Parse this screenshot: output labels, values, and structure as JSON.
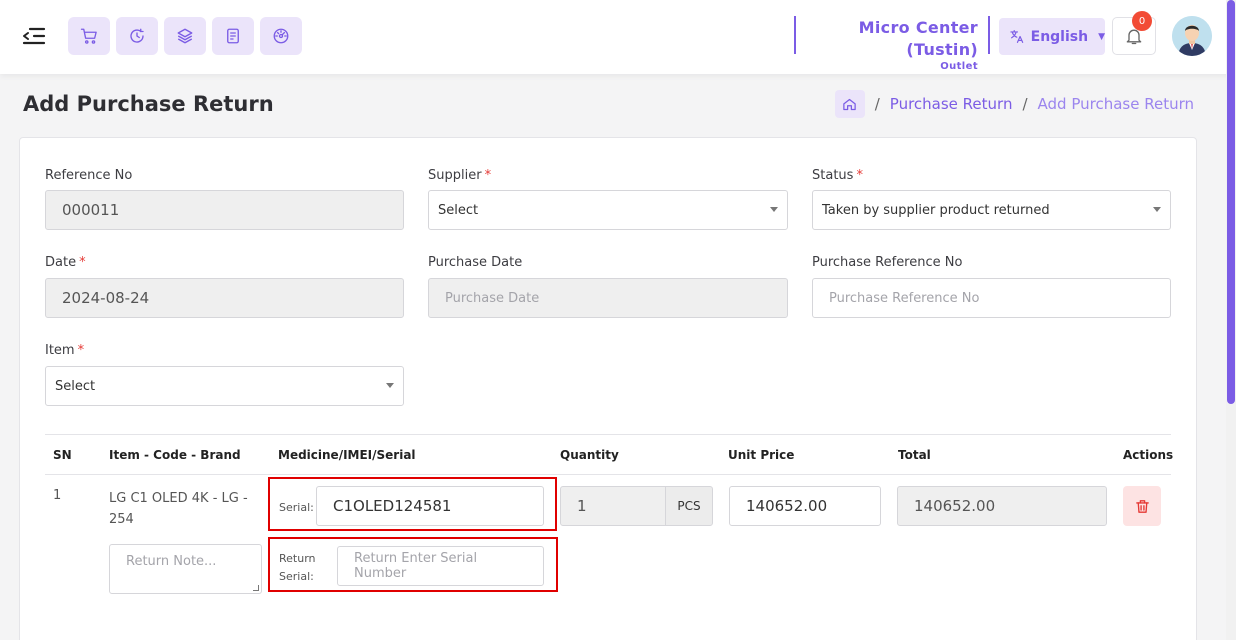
{
  "header": {
    "outlet_name": "Micro Center (Tustin)",
    "outlet_sub": "Outlet",
    "language": "English",
    "notification_count": "0",
    "quick_icons": [
      "cart-icon",
      "clock-icon",
      "layers-icon",
      "receipt-icon",
      "dashboard-icon"
    ]
  },
  "page": {
    "title": "Add Purchase Return",
    "breadcrumb": [
      "Purchase Return",
      "Add Purchase Return"
    ]
  },
  "form": {
    "reference_no": {
      "label": "Reference No",
      "value": "000011"
    },
    "supplier": {
      "label": "Supplier",
      "value": "Select"
    },
    "status": {
      "label": "Status",
      "value": "Taken by supplier product returned"
    },
    "date": {
      "label": "Date",
      "value": "2024-08-24"
    },
    "purchase_date": {
      "label": "Purchase Date",
      "placeholder": "Purchase Date"
    },
    "purchase_ref": {
      "label": "Purchase Reference No",
      "placeholder": "Purchase Reference No"
    },
    "item": {
      "label": "Item",
      "value": "Select"
    },
    "required_mark": "*"
  },
  "table": {
    "headers": [
      "SN",
      "Item - Code - Brand",
      "Medicine/IMEI/Serial",
      "Quantity",
      "Unit Price",
      "Total",
      "Actions"
    ],
    "row": {
      "sn": "1",
      "item_line1": "LG C1 OLED 4K - LG -",
      "item_line2": "254",
      "serial_label": "Serial:",
      "serial_value": "C1OLED124581",
      "return_serial_label_1": "Return",
      "return_serial_label_2": "Serial:",
      "return_serial_placeholder": "Return Enter Serial Number",
      "quantity": "1",
      "unit": "PCS",
      "unit_price": "140652.00",
      "total": "140652.00",
      "note_placeholder": "Return Note..."
    }
  },
  "colors": {
    "accent": "#7b5ce5",
    "accent_light": "#ebe4fa",
    "danger": "#e53935",
    "highlight_box": "#e00000"
  }
}
